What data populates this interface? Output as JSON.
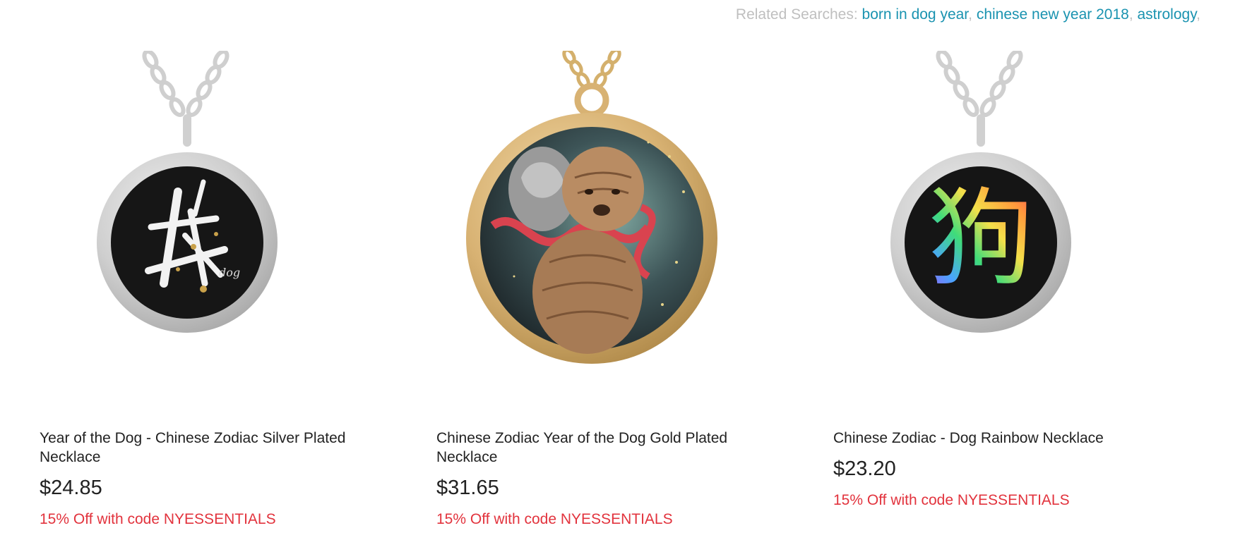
{
  "related": {
    "label": "Related Searches:",
    "links": [
      "born in dog year",
      "chinese new year 2018",
      "astrology"
    ]
  },
  "products": [
    {
      "image": "silver-necklace-dog-calligraphy",
      "title": "Year of the Dog - Chinese Zodiac Silver Plated Necklace",
      "price": "$24.85",
      "promo": "15% Off with code NYESSENTIALS",
      "pendant_text": "dog"
    },
    {
      "image": "gold-necklace-shar-pei-foo-dog",
      "title": "Chinese Zodiac Year of the Dog Gold Plated Necklace",
      "price": "$31.65",
      "promo": "15% Off with code NYESSENTIALS"
    },
    {
      "image": "silver-necklace-rainbow-dog-character",
      "title": "Chinese Zodiac - Dog Rainbow Necklace",
      "price": "$23.20",
      "promo": "15% Off with code NYESSENTIALS",
      "pendant_text": "狗"
    }
  ],
  "colors": {
    "link": "#1a93b0",
    "label": "#bfbfbf",
    "promo": "#e2333d",
    "silver": "#c8c8c8",
    "gold": "#d8b273"
  }
}
